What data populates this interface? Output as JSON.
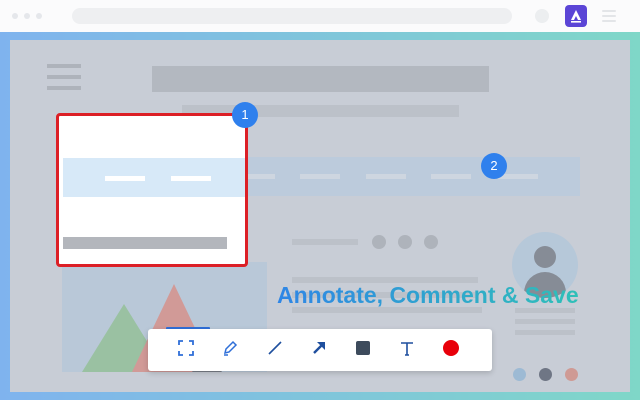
{
  "caption": {
    "text": "Annotate, Comment & Save"
  },
  "badges": [
    {
      "label": "1"
    },
    {
      "label": "2"
    }
  ],
  "toolbar": {
    "tools": [
      {
        "name": "select-area",
        "icon": "crop-select-icon"
      },
      {
        "name": "highlighter",
        "icon": "pencil-icon"
      },
      {
        "name": "line",
        "icon": "line-icon"
      },
      {
        "name": "arrow",
        "icon": "arrow-icon"
      },
      {
        "name": "rectangle",
        "icon": "square-icon"
      },
      {
        "name": "text",
        "icon": "text-icon"
      },
      {
        "name": "color",
        "icon": "color-dot-icon"
      }
    ],
    "active_tool": "select-area"
  },
  "colors": {
    "accent": "#2f80ed",
    "selection_border": "#dc1f26",
    "brand_logo": "#5b45d6",
    "color_picker": "#e8000a"
  }
}
